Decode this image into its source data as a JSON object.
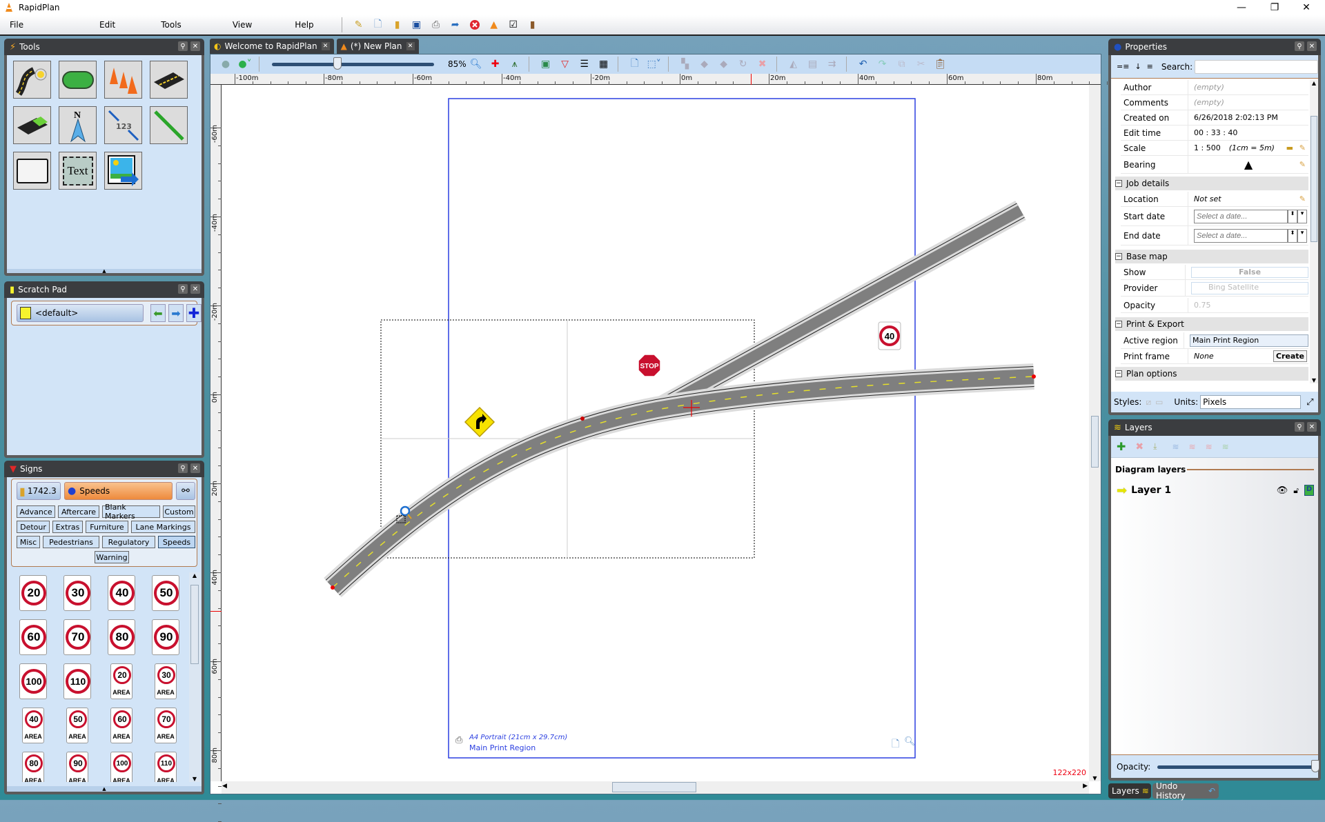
{
  "window": {
    "title": "RapidPlan",
    "minimize": "—",
    "restore": "❐",
    "close": "✕"
  },
  "menu": [
    "File",
    "Edit",
    "Tools",
    "View",
    "Help"
  ],
  "toolbar_icons": [
    "open-wizard-icon",
    "new-document-icon",
    "open-folder-icon",
    "save-icon",
    "print-icon",
    "export-icon",
    "close-red-icon",
    "cone-icon",
    "checkbox-icon",
    "exit-door-icon"
  ],
  "panels": {
    "tools": {
      "title": "Tools",
      "items": [
        "road-tool",
        "shape-tool",
        "cones-tool",
        "road-section-tool",
        "area-tool",
        "north-arrow-tool",
        "measure-tool",
        "line-tool",
        "rectangle-tool",
        "text-tool",
        "image-tool"
      ],
      "text_tile_label": "Text",
      "measure_label": "123",
      "north_label": "N"
    },
    "scratch_pad": {
      "title": "Scratch Pad",
      "selected": "<default>"
    },
    "signs": {
      "title": "Signs",
      "library": "1742.3",
      "category": "Speeds",
      "tabs": [
        "Advance",
        "Aftercare",
        "Blank Markers",
        "Custom",
        "Detour",
        "Extras",
        "Furniture",
        "Lane Markings",
        "Misc",
        "Pedestrians",
        "Regulatory",
        "Speeds",
        "Warning"
      ],
      "active_tab": "Speeds",
      "speed_signs": [
        "20",
        "30",
        "40",
        "50",
        "60",
        "70",
        "80",
        "90",
        "100",
        "110"
      ],
      "area_signs": [
        "20",
        "30",
        "40",
        "50",
        "60",
        "70",
        "80",
        "90",
        "100",
        "110"
      ],
      "area_label": "AREA"
    }
  },
  "doc_tabs": [
    {
      "label": "Welcome to RapidPlan",
      "active": false
    },
    {
      "label": "(*) New Plan",
      "active": true
    }
  ],
  "editor": {
    "zoom": "85%",
    "zoom_fraction": 0.4,
    "ruler_h": [
      "-100m",
      "-80m",
      "-60m",
      "-40m",
      "-20m",
      "0m",
      "20m",
      "40m",
      "60m",
      "80m"
    ],
    "ruler_v": [
      "-60m",
      "-40m",
      "-20m",
      "0m",
      "20m",
      "40m",
      "60m",
      "80m"
    ],
    "print_region": {
      "paper": "A4 Portrait (21cm x 29.7cm)",
      "name": "Main Print Region"
    },
    "canvas_size": "122x220",
    "signs_on_canvas": {
      "stop": "STOP",
      "speed": "40"
    }
  },
  "properties": {
    "title": "Properties",
    "search_label": "Search:",
    "search_value": "",
    "rows": [
      {
        "key": "Author",
        "value": "(empty)"
      },
      {
        "key": "Comments",
        "value": "(empty)"
      },
      {
        "key": "Created on",
        "value": "6/26/2018 2:02:13 PM"
      },
      {
        "key": "Edit time",
        "value": "00 : 33 : 40"
      },
      {
        "key": "Scale",
        "value": "1 : 500",
        "note": "(1cm = 5m)"
      },
      {
        "key": "Bearing",
        "value": "▲"
      }
    ],
    "job_details": {
      "title": "Job details",
      "location_label": "Location",
      "location": "Not set",
      "start_label": "Start date",
      "end_label": "End date",
      "date_placeholder": "Select a date..."
    },
    "base_map": {
      "title": "Base map",
      "show_label": "Show",
      "show": "False",
      "provider_label": "Provider",
      "provider": "Bing Satellite",
      "opacity_label": "Opacity",
      "opacity": "0.75"
    },
    "print_export": {
      "title": "Print & Export",
      "active_region_label": "Active region",
      "active_region": "Main Print Region",
      "print_frame_label": "Print frame",
      "print_frame": "None",
      "create": "Create"
    },
    "plan_options": {
      "title": "Plan options"
    },
    "styles_label": "Styles:",
    "units_label": "Units:",
    "units": "Pixels"
  },
  "layers": {
    "title": "Layers",
    "section": "Diagram layers",
    "items": [
      {
        "name": "Layer 1"
      }
    ],
    "opacity_label": "Opacity:",
    "opacity_fraction": 1.0
  },
  "bottom_tabs": [
    "Layers",
    "Undo History"
  ]
}
